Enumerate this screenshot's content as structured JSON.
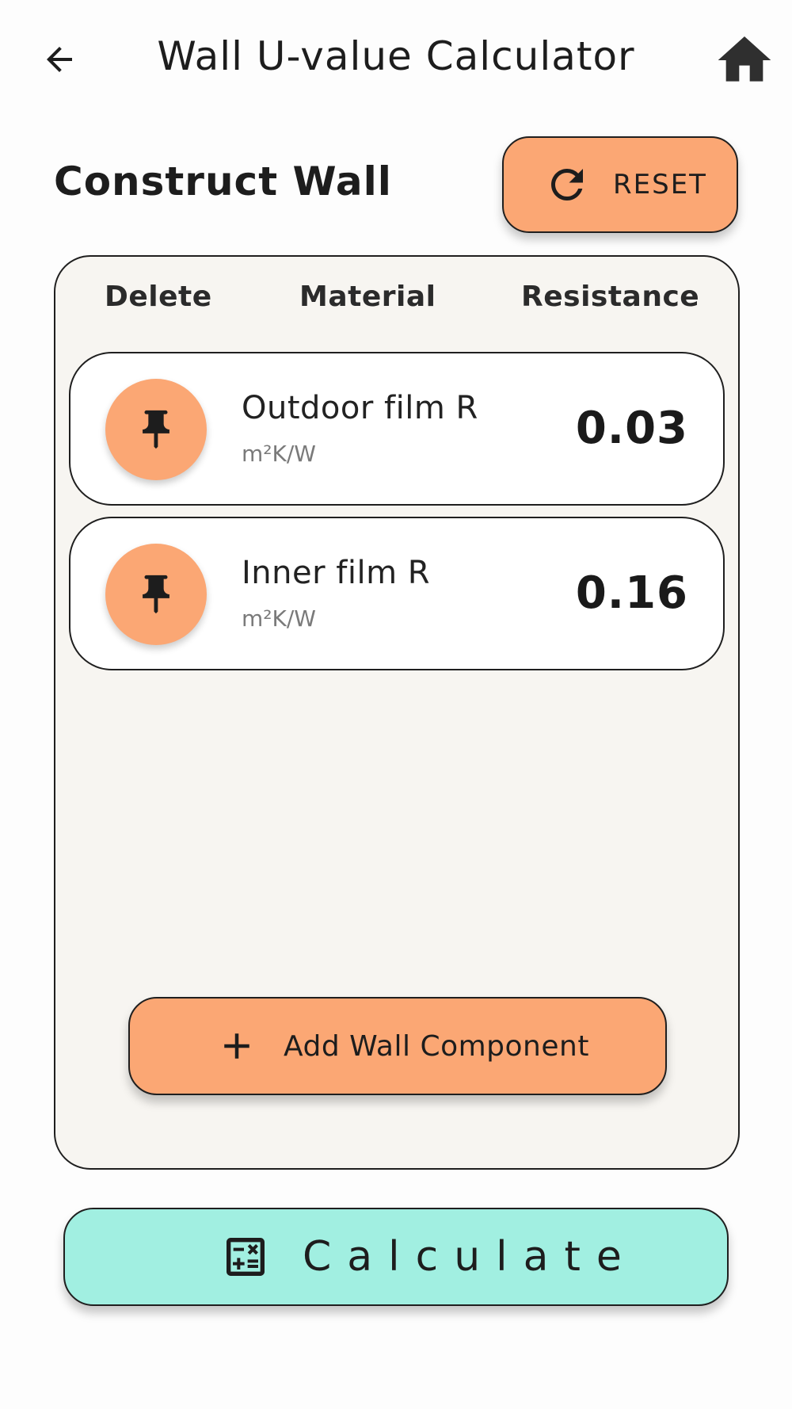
{
  "app_bar": {
    "title": "Wall U-value Calculator",
    "back_icon": "arrow-left-icon",
    "home_icon": "home-icon"
  },
  "section": {
    "title": "Construct Wall",
    "reset_label": "RESET",
    "reset_icon": "refresh-icon"
  },
  "table": {
    "headers": {
      "delete": "Delete",
      "material": "Material",
      "resistance": "Resistance"
    },
    "rows": [
      {
        "name": "Outdoor film R",
        "unit": "m²K/W",
        "value": "0.03",
        "icon": "pin-icon"
      },
      {
        "name": "Inner film R",
        "unit": "m²K/W",
        "value": "0.16",
        "icon": "pin-icon"
      }
    ]
  },
  "add_button": {
    "label": "Add Wall Component",
    "icon": "plus-icon"
  },
  "calculate_button": {
    "label": "Calculate",
    "icon": "calculator-icon"
  },
  "colors": {
    "accent_orange": "#fba774",
    "accent_teal": "#a1efe1",
    "card_bg": "#f7f5f1",
    "border": "#1f1f1f"
  }
}
